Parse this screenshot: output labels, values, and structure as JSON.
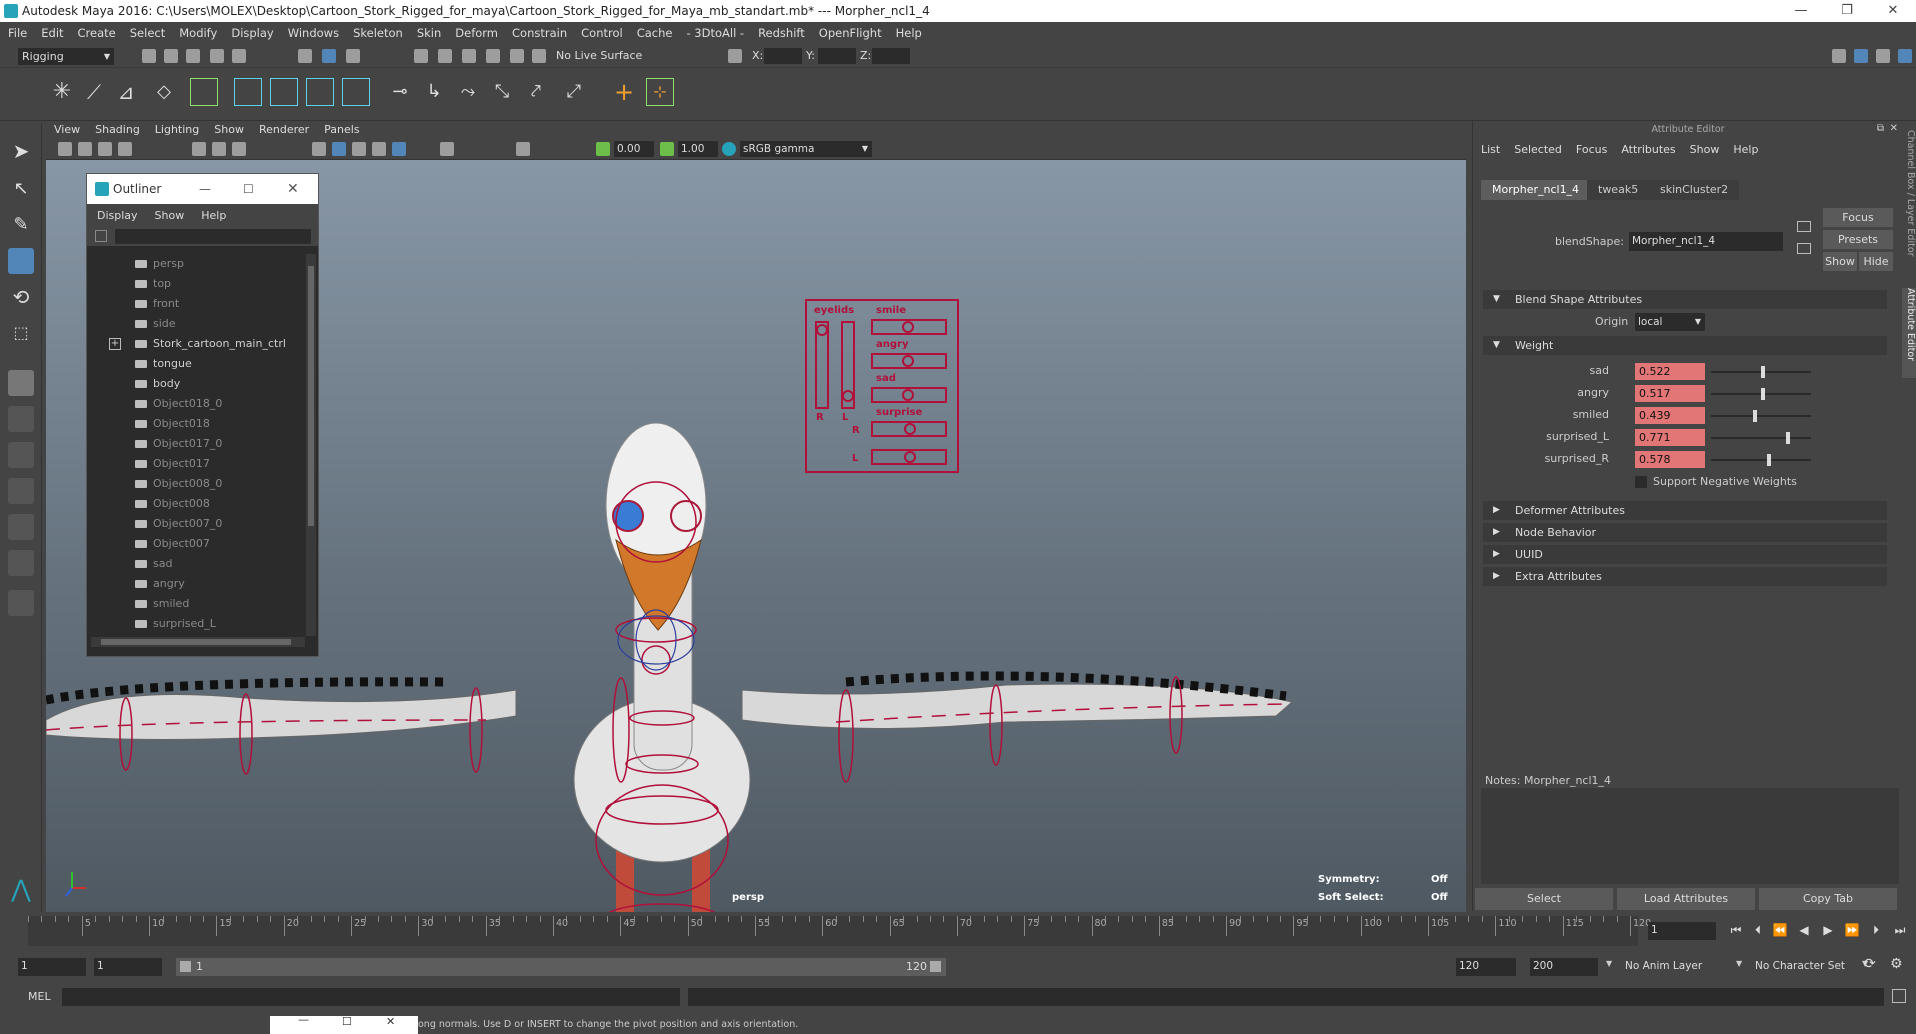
{
  "window": {
    "title": "Autodesk Maya 2016: C:\\Users\\MOLEX\\Desktop\\Cartoon_Stork_Rigged_for_maya\\Cartoon_Stork_Rigged_for_Maya_mb_standart.mb*   ---   Morpher_ncl1_4",
    "min": "—",
    "max": "❐",
    "close": "✕"
  },
  "menubar": [
    "File",
    "Edit",
    "Create",
    "Select",
    "Modify",
    "Display",
    "Windows",
    "Skeleton",
    "Skin",
    "Deform",
    "Constrain",
    "Control",
    "Cache",
    "- 3DtoAll -",
    "Redshift",
    "OpenFlight",
    "Help"
  ],
  "status": {
    "mode": "Rigging",
    "live_surface": "No Live Surface",
    "x_label": "X:",
    "y_label": "Y:",
    "z_label": "Z:"
  },
  "viewport": {
    "menu": [
      "View",
      "Shading",
      "Lighting",
      "Show",
      "Renderer",
      "Panels"
    ],
    "near": "0.00",
    "far": "1.00",
    "colorspace": "sRGB gamma",
    "camera_label": "persp",
    "symmetry_label": "Symmetry:",
    "symmetry_value": "Off",
    "soft_select_label": "Soft Select:",
    "soft_select_value": "Off",
    "face_panel": {
      "eyelids": "eyelids",
      "smile": "smile",
      "angry": "angry",
      "sad": "sad",
      "surprise": "surprise",
      "r": "R",
      "l": "L",
      "r2": "R",
      "l2": "L"
    }
  },
  "outliner": {
    "title": "Outliner",
    "menu": [
      "Display",
      "Show",
      "Help"
    ],
    "items": [
      {
        "label": "persp",
        "dim": true
      },
      {
        "label": "top",
        "dim": true
      },
      {
        "label": "front",
        "dim": true
      },
      {
        "label": "side",
        "dim": true
      },
      {
        "label": "Stork_cartoon_main_ctrl",
        "dim": false
      },
      {
        "label": "tongue",
        "dim": false
      },
      {
        "label": "body",
        "dim": false
      },
      {
        "label": "Object018_0",
        "dim": true
      },
      {
        "label": "Object018",
        "dim": true
      },
      {
        "label": "Object017_0",
        "dim": true
      },
      {
        "label": "Object017",
        "dim": true
      },
      {
        "label": "Object008_0",
        "dim": true
      },
      {
        "label": "Object008",
        "dim": true
      },
      {
        "label": "Object007_0",
        "dim": true
      },
      {
        "label": "Object007",
        "dim": true
      },
      {
        "label": "sad",
        "dim": true
      },
      {
        "label": "angry",
        "dim": true
      },
      {
        "label": "smiled",
        "dim": true
      },
      {
        "label": "surprised_L",
        "dim": true
      }
    ]
  },
  "attribute_editor": {
    "title": "Attribute Editor",
    "menu": [
      "List",
      "Selected",
      "Focus",
      "Attributes",
      "Show",
      "Help"
    ],
    "tabs": [
      "Morpher_ncl1_4",
      "tweak5",
      "skinCluster2"
    ],
    "blendshape_label": "blendShape:",
    "blendshape_value": "Morpher_ncl1_4",
    "focus_btn": "Focus",
    "presets_btn": "Presets",
    "show_btn": "Show",
    "hide_btn": "Hide",
    "sec_blend": "Blend Shape Attributes",
    "origin_label": "Origin",
    "origin_value": "local",
    "sec_weight": "Weight",
    "weights": [
      {
        "name": "sad",
        "value": "0.522",
        "level": 0.522
      },
      {
        "name": "angry",
        "value": "0.517",
        "level": 0.517
      },
      {
        "name": "smiled",
        "value": "0.439",
        "level": 0.439
      },
      {
        "name": "surprised_L",
        "value": "0.771",
        "level": 0.771
      },
      {
        "name": "surprised_R",
        "value": "0.578",
        "level": 0.578
      }
    ],
    "support_negative": "Support Negative Weights",
    "sections": [
      "Deformer Attributes",
      "Node Behavior",
      "UUID",
      "Extra Attributes"
    ],
    "notes_label": "Notes:  Morpher_ncl1_4",
    "btn_select": "Select",
    "btn_load": "Load Attributes",
    "btn_copy": "Copy Tab"
  },
  "side_tabs": "Channel Box / Layer Editor",
  "side_tabs2": "Attribute Editor",
  "timeline": {
    "ticks": [
      "5",
      "10",
      "15",
      "20",
      "25",
      "30",
      "35",
      "40",
      "45",
      "50",
      "55",
      "60",
      "65",
      "70",
      "75",
      "80",
      "85",
      "90",
      "95",
      "100",
      "105",
      "110",
      "115",
      "120"
    ],
    "start_label": "1",
    "current_frame": "1"
  },
  "range": {
    "start": "1",
    "playback_start": "1",
    "slider_start": "1",
    "slider_end": "120",
    "end": "120",
    "anim_end": "200",
    "anim_layer": "No Anim Layer",
    "char_set": "No Character Set"
  },
  "cmdline": {
    "lang": "MEL"
  },
  "helpline": {
    "text": "ong normals. Use D or INSERT to change the pivot position and axis orientation."
  }
}
